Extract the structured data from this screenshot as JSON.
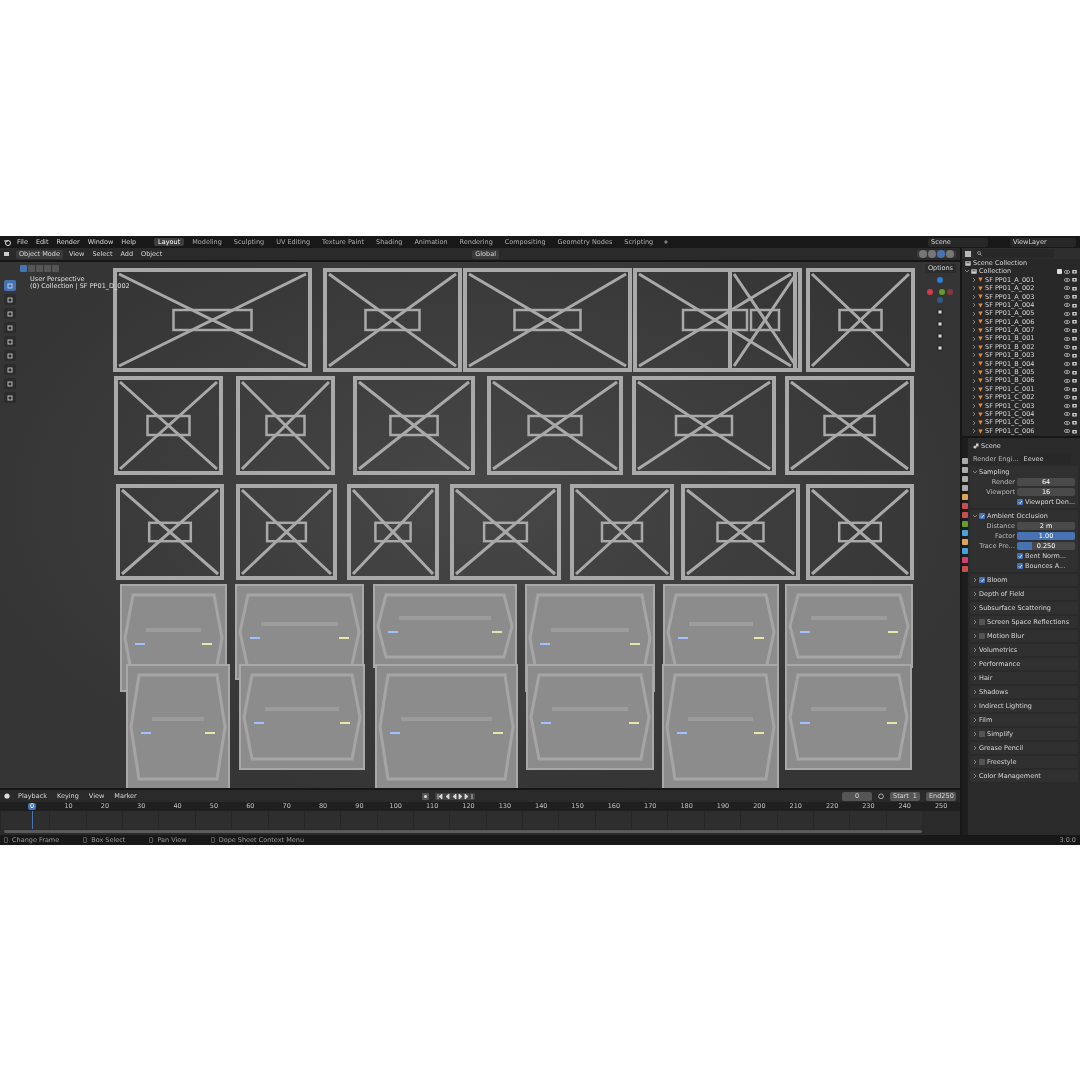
{
  "top_bar": {
    "menus": [
      "File",
      "Edit",
      "Render",
      "Window",
      "Help"
    ],
    "workspaces": [
      {
        "label": "Layout",
        "selected": true
      },
      {
        "label": "Modeling",
        "selected": false
      },
      {
        "label": "Sculpting",
        "selected": false
      },
      {
        "label": "UV Editing",
        "selected": false
      },
      {
        "label": "Texture Paint",
        "selected": false
      },
      {
        "label": "Shading",
        "selected": false
      },
      {
        "label": "Animation",
        "selected": false
      },
      {
        "label": "Rendering",
        "selected": false
      },
      {
        "label": "Compositing",
        "selected": false
      },
      {
        "label": "Geometry Nodes",
        "selected": false
      },
      {
        "label": "Scripting",
        "selected": false
      }
    ],
    "add_workspace": "+",
    "scene": "Scene",
    "view_layer": "ViewLayer"
  },
  "viewport": {
    "mode": "Object Mode",
    "menus": [
      "View",
      "Select",
      "Add",
      "Object"
    ],
    "orientation": "Global",
    "options": "Options",
    "view_name": "User Perspective",
    "active_object": "(0) Collection | SF PP01_D_002",
    "select_modes": [
      {
        "selected": true
      },
      {
        "selected": false
      },
      {
        "selected": false
      },
      {
        "selected": false
      },
      {
        "selected": false
      }
    ],
    "shading_modes": [
      {
        "selected": false
      },
      {
        "selected": false
      },
      {
        "selected": true
      },
      {
        "selected": false
      }
    ],
    "tools": [
      {
        "selected": true
      },
      {
        "selected": false
      },
      {
        "selected": false
      },
      {
        "selected": false
      },
      {
        "selected": false
      },
      {
        "selected": false
      },
      {
        "selected": false
      },
      {
        "selected": false
      },
      {
        "selected": false
      }
    ]
  },
  "outliner": {
    "root": "Scene Collection",
    "collection": {
      "label": "Collection",
      "expanded": true,
      "checked": true,
      "children": [
        {
          "label": "SF PP01_A_001"
        },
        {
          "label": "SF PP01_A_002"
        },
        {
          "label": "SF PP01_A_003"
        },
        {
          "label": "SF PP01_A_004"
        },
        {
          "label": "SF PP01_A_005"
        },
        {
          "label": "SF PP01_A_006"
        },
        {
          "label": "SF PP01_A_007"
        },
        {
          "label": "SF PP01_B_001"
        },
        {
          "label": "SF PP01_B_002"
        },
        {
          "label": "SF PP01_B_003"
        },
        {
          "label": "SF PP01_B_004"
        },
        {
          "label": "SF PP01_B_005"
        },
        {
          "label": "SF PP01_B_006"
        },
        {
          "label": "SF PP01_C_001"
        },
        {
          "label": "SF PP01_C_002"
        },
        {
          "label": "SF PP01_C_003"
        },
        {
          "label": "SF PP01_C_004"
        },
        {
          "label": "SF PP01_C_005"
        },
        {
          "label": "SF PP01_C_006"
        }
      ]
    }
  },
  "properties": {
    "context": "Scene",
    "render_engine": {
      "label": "Render Engi...",
      "value": "Eevee"
    },
    "sections": [
      {
        "label": "Sampling",
        "kind": "plain",
        "expanded": true,
        "fields": [
          {
            "kind": "number",
            "label": "Render",
            "value": "64"
          },
          {
            "kind": "number",
            "label": "Viewport",
            "value": "16"
          },
          {
            "kind": "checkbox",
            "label": "Viewport Den...",
            "checked": true
          }
        ]
      },
      {
        "label": "Ambient Occlusion",
        "kind": "toggle",
        "checked": true,
        "expanded": true,
        "fields": [
          {
            "kind": "number",
            "label": "Distance",
            "value": "2 m"
          },
          {
            "kind": "slider",
            "label": "Factor",
            "value": "1.00",
            "level": 1
          },
          {
            "kind": "slider",
            "label": "Trace Pre...",
            "value": "0.250",
            "level": 0.25
          },
          {
            "kind": "checkbox",
            "label": "Bent Norm...",
            "checked": true
          },
          {
            "kind": "checkbox",
            "label": "Bounces A...",
            "checked": true
          }
        ]
      },
      {
        "label": "Bloom",
        "kind": "toggle",
        "checked": true,
        "expanded": false
      },
      {
        "label": "Depth of Field",
        "kind": "plain",
        "expanded": false
      },
      {
        "label": "Subsurface Scattering",
        "kind": "plain",
        "expanded": false
      },
      {
        "label": "Screen Space Reflections",
        "kind": "toggle",
        "checked": false,
        "expanded": false
      },
      {
        "label": "Motion Blur",
        "kind": "toggle",
        "checked": false,
        "expanded": false
      },
      {
        "label": "Volumetrics",
        "kind": "plain",
        "expanded": false
      },
      {
        "label": "Performance",
        "kind": "plain",
        "expanded": false
      },
      {
        "label": "Hair",
        "kind": "plain",
        "expanded": false
      },
      {
        "label": "Shadows",
        "kind": "plain",
        "expanded": false
      },
      {
        "label": "Indirect Lighting",
        "kind": "plain",
        "expanded": false
      },
      {
        "label": "Film",
        "kind": "plain",
        "expanded": false
      },
      {
        "label": "Simplify",
        "kind": "toggle",
        "checked": false,
        "expanded": false
      },
      {
        "label": "Grease Pencil",
        "kind": "plain",
        "expanded": false
      },
      {
        "label": "Freestyle",
        "kind": "toggle",
        "checked": false,
        "expanded": false
      },
      {
        "label": "Color Management",
        "kind": "plain",
        "expanded": false
      }
    ]
  },
  "timeline": {
    "menus": [
      "Playback",
      "Keying",
      "View",
      "Marker"
    ],
    "current_frame": "0",
    "start": {
      "label": "Start",
      "value": "1"
    },
    "end": {
      "label": "End",
      "value": "250"
    },
    "ticks": [
      {
        "label": "0",
        "selected": true
      },
      {
        "label": "10",
        "selected": false
      },
      {
        "label": "20",
        "selected": false
      },
      {
        "label": "30",
        "selected": false
      },
      {
        "label": "40",
        "selected": false
      },
      {
        "label": "50",
        "selected": false
      },
      {
        "label": "60",
        "selected": false
      },
      {
        "label": "70",
        "selected": false
      },
      {
        "label": "80",
        "selected": false
      },
      {
        "label": "90",
        "selected": false
      },
      {
        "label": "100",
        "selected": false
      },
      {
        "label": "110",
        "selected": false
      },
      {
        "label": "120",
        "selected": false
      },
      {
        "label": "130",
        "selected": false
      },
      {
        "label": "140",
        "selected": false
      },
      {
        "label": "150",
        "selected": false
      },
      {
        "label": "160",
        "selected": false
      },
      {
        "label": "170",
        "selected": false
      },
      {
        "label": "180",
        "selected": false
      },
      {
        "label": "190",
        "selected": false
      },
      {
        "label": "200",
        "selected": false
      },
      {
        "label": "210",
        "selected": false
      },
      {
        "label": "220",
        "selected": false
      },
      {
        "label": "230",
        "selected": false
      },
      {
        "label": "240",
        "selected": false
      },
      {
        "label": "250",
        "selected": false
      }
    ]
  },
  "status_bar": {
    "hints": [
      "Change Frame",
      "Box Select",
      "Pan View",
      "Dope Sheet Context Menu"
    ],
    "version": "3.0.0"
  }
}
